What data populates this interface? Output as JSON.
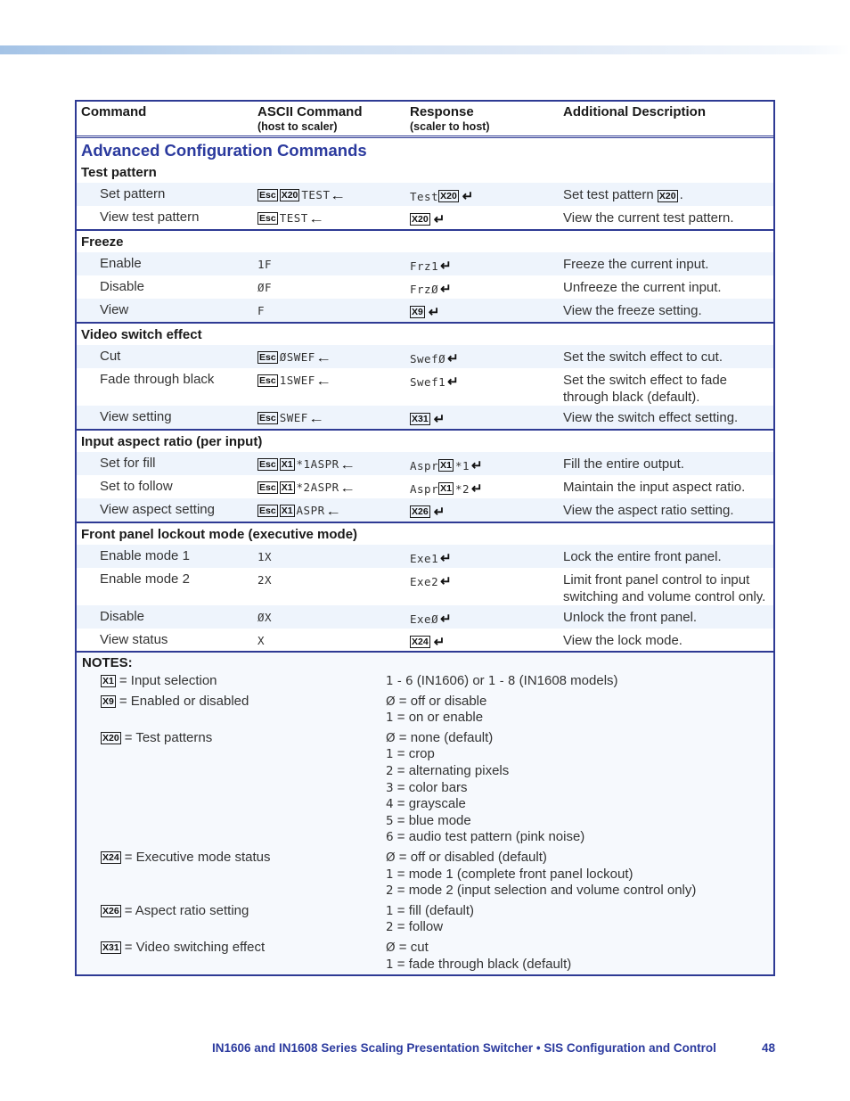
{
  "colors": {
    "accent": "#2e3a94",
    "heading_blue": "#2b3a9e",
    "row_shade": "#eef4fc"
  },
  "table": {
    "headers": {
      "command": "Command",
      "ascii": "ASCII Command",
      "ascii_sub": "(host to scaler)",
      "response": "Response",
      "response_sub": "(scaler to host)",
      "description": "Additional Description"
    },
    "section_title": "Advanced Configuration Commands",
    "groups": [
      {
        "title": "Test pattern",
        "rows": [
          {
            "name": "Set pattern",
            "ascii": [
              {
                "t": "box",
                "v": "Esc"
              },
              {
                "t": "box",
                "v": "X20"
              },
              {
                "t": "text",
                "v": "TEST"
              },
              {
                "t": "arrow-left"
              }
            ],
            "response": [
              {
                "t": "text",
                "v": "Test"
              },
              {
                "t": "box",
                "v": "X20"
              },
              {
                "t": "return"
              }
            ],
            "description": [
              {
                "t": "plain",
                "v": "Set test pattern "
              },
              {
                "t": "box",
                "v": "X20"
              },
              {
                "t": "plain",
                "v": "."
              }
            ],
            "shade": true
          },
          {
            "name": "View test pattern",
            "ascii": [
              {
                "t": "box",
                "v": "Esc"
              },
              {
                "t": "text",
                "v": "TEST"
              },
              {
                "t": "arrow-left"
              }
            ],
            "response": [
              {
                "t": "box",
                "v": "X20"
              },
              {
                "t": "return"
              }
            ],
            "description": [
              {
                "t": "plain",
                "v": "View the current test pattern."
              }
            ],
            "shade": false
          }
        ]
      },
      {
        "title": "Freeze",
        "rows": [
          {
            "name": "Enable",
            "ascii": [
              {
                "t": "text",
                "v": "1F"
              }
            ],
            "response": [
              {
                "t": "text",
                "v": "Frz1"
              },
              {
                "t": "return"
              }
            ],
            "description": [
              {
                "t": "plain",
                "v": "Freeze the current input."
              }
            ],
            "shade": true
          },
          {
            "name": "Disable",
            "ascii": [
              {
                "t": "text",
                "v": "ØF"
              }
            ],
            "response": [
              {
                "t": "text",
                "v": "FrzØ"
              },
              {
                "t": "return"
              }
            ],
            "description": [
              {
                "t": "plain",
                "v": "Unfreeze the current input."
              }
            ],
            "shade": false
          },
          {
            "name": "View",
            "ascii": [
              {
                "t": "text",
                "v": "F"
              }
            ],
            "response": [
              {
                "t": "box",
                "v": "X9"
              },
              {
                "t": "return"
              }
            ],
            "description": [
              {
                "t": "plain",
                "v": "View the freeze setting."
              }
            ],
            "shade": true
          }
        ]
      },
      {
        "title": "Video switch effect",
        "rows": [
          {
            "name": "Cut",
            "ascii": [
              {
                "t": "box",
                "v": "Esc"
              },
              {
                "t": "text",
                "v": "ØSWEF"
              },
              {
                "t": "arrow-left"
              }
            ],
            "response": [
              {
                "t": "text",
                "v": "SwefØ"
              },
              {
                "t": "return"
              }
            ],
            "description": [
              {
                "t": "plain",
                "v": "Set the switch effect to cut."
              }
            ],
            "shade": true
          },
          {
            "name": "Fade through black",
            "ascii": [
              {
                "t": "box",
                "v": "Esc"
              },
              {
                "t": "text",
                "v": "1SWEF"
              },
              {
                "t": "arrow-left"
              }
            ],
            "response": [
              {
                "t": "text",
                "v": "Swef1"
              },
              {
                "t": "return"
              }
            ],
            "description": [
              {
                "t": "plain",
                "v": "Set the switch effect to fade through black (default)."
              }
            ],
            "shade": false,
            "tall": true
          },
          {
            "name": "View setting",
            "ascii": [
              {
                "t": "box",
                "v": "Esc"
              },
              {
                "t": "text",
                "v": "SWEF"
              },
              {
                "t": "arrow-left"
              }
            ],
            "response": [
              {
                "t": "box",
                "v": "X31"
              },
              {
                "t": "return"
              }
            ],
            "description": [
              {
                "t": "plain",
                "v": "View the switch effect setting."
              }
            ],
            "shade": true
          }
        ]
      },
      {
        "title": "Input aspect ratio (per input)",
        "rows": [
          {
            "name": "Set for fill",
            "ascii": [
              {
                "t": "box",
                "v": "Esc"
              },
              {
                "t": "box",
                "v": "X1"
              },
              {
                "t": "text",
                "v": "*1ASPR"
              },
              {
                "t": "arrow-left"
              }
            ],
            "response": [
              {
                "t": "text",
                "v": "Aspr"
              },
              {
                "t": "box",
                "v": "X1"
              },
              {
                "t": "text",
                "v": "*1"
              },
              {
                "t": "return"
              }
            ],
            "description": [
              {
                "t": "plain",
                "v": "Fill the entire output."
              }
            ],
            "shade": true
          },
          {
            "name": "Set to follow",
            "ascii": [
              {
                "t": "box",
                "v": "Esc"
              },
              {
                "t": "box",
                "v": "X1"
              },
              {
                "t": "text",
                "v": "*2ASPR"
              },
              {
                "t": "arrow-left"
              }
            ],
            "response": [
              {
                "t": "text",
                "v": "Aspr"
              },
              {
                "t": "box",
                "v": "X1"
              },
              {
                "t": "text",
                "v": "*2"
              },
              {
                "t": "return"
              }
            ],
            "description": [
              {
                "t": "plain",
                "v": "Maintain the input aspect ratio."
              }
            ],
            "shade": false
          },
          {
            "name": "View aspect setting",
            "ascii": [
              {
                "t": "box",
                "v": "Esc"
              },
              {
                "t": "box",
                "v": "X1"
              },
              {
                "t": "text",
                "v": "ASPR"
              },
              {
                "t": "arrow-left"
              }
            ],
            "response": [
              {
                "t": "box",
                "v": "X26"
              },
              {
                "t": "return"
              }
            ],
            "description": [
              {
                "t": "plain",
                "v": "View the aspect ratio setting."
              }
            ],
            "shade": true
          }
        ]
      },
      {
        "title": "Front panel lockout mode (executive mode)",
        "rows": [
          {
            "name": "Enable mode 1",
            "ascii": [
              {
                "t": "text",
                "v": "1X"
              }
            ],
            "response": [
              {
                "t": "text",
                "v": "Exe1"
              },
              {
                "t": "return"
              }
            ],
            "description": [
              {
                "t": "plain",
                "v": "Lock the entire front panel."
              }
            ],
            "shade": true
          },
          {
            "name": "Enable mode 2",
            "ascii": [
              {
                "t": "text",
                "v": "2X"
              }
            ],
            "response": [
              {
                "t": "text",
                "v": "Exe2"
              },
              {
                "t": "return"
              }
            ],
            "description": [
              {
                "t": "plain",
                "v": "Limit front panel control to input switching and volume control only."
              }
            ],
            "shade": false,
            "tall": true
          },
          {
            "name": "Disable",
            "ascii": [
              {
                "t": "text",
                "v": "ØX"
              }
            ],
            "response": [
              {
                "t": "text",
                "v": "ExeØ"
              },
              {
                "t": "return"
              }
            ],
            "description": [
              {
                "t": "plain",
                "v": "Unlock the front panel."
              }
            ],
            "shade": true
          },
          {
            "name": "View status",
            "ascii": [
              {
                "t": "text",
                "v": "X"
              }
            ],
            "response": [
              {
                "t": "box",
                "v": "X24"
              },
              {
                "t": "return"
              }
            ],
            "description": [
              {
                "t": "plain",
                "v": "View the lock mode."
              }
            ],
            "shade": false
          }
        ]
      }
    ]
  },
  "notes": {
    "title": "NOTES:",
    "items": [
      {
        "var": "X1",
        "label": "= Input selection",
        "values": [
          {
            "num": "1 - 6",
            "text": " (IN1606) or "
          },
          {
            "num": "1 - 8",
            "text": " (IN1608 models)",
            "inline": true
          }
        ]
      },
      {
        "var": "X9",
        "label": "= Enabled or disabled",
        "values": [
          {
            "num": "Ø",
            "text": " = off or disable"
          },
          {
            "num": "1",
            "text": " = on or enable"
          }
        ]
      },
      {
        "var": "X20",
        "label": "= Test patterns",
        "values": [
          {
            "num": "Ø",
            "text": " = none (default)"
          },
          {
            "num": "1",
            "text": " = crop"
          },
          {
            "num": "2",
            "text": " = alternating pixels"
          },
          {
            "num": "3",
            "text": " = color bars"
          },
          {
            "num": "4",
            "text": " = grayscale"
          },
          {
            "num": "5",
            "text": " = blue mode"
          },
          {
            "num": "6",
            "text": " = audio test pattern (pink noise)"
          }
        ]
      },
      {
        "var": "X24",
        "label": "= Executive mode status",
        "values": [
          {
            "num": "Ø",
            "text": " = off or disabled (default)"
          },
          {
            "num": "1",
            "text": " = mode 1 (complete front panel lockout)"
          },
          {
            "num": "2",
            "text": " = mode 2 (input selection and volume control only)"
          }
        ]
      },
      {
        "var": "X26",
        "label": "= Aspect ratio setting",
        "values": [
          {
            "num": "1",
            "text": " = fill (default)"
          },
          {
            "num": "2",
            "text": " = follow"
          }
        ]
      },
      {
        "var": "X31",
        "label": "= Video switching effect",
        "values": [
          {
            "num": "Ø",
            "text": " = cut"
          },
          {
            "num": "1",
            "text": " = fade through black (default)"
          }
        ]
      }
    ]
  },
  "footer": {
    "title": "IN1606 and IN1608 Series Scaling Presentation Switcher • SIS Configuration and Control",
    "page": "48"
  },
  "glyphs": {
    "arrow_left": "←",
    "return": "↵"
  }
}
